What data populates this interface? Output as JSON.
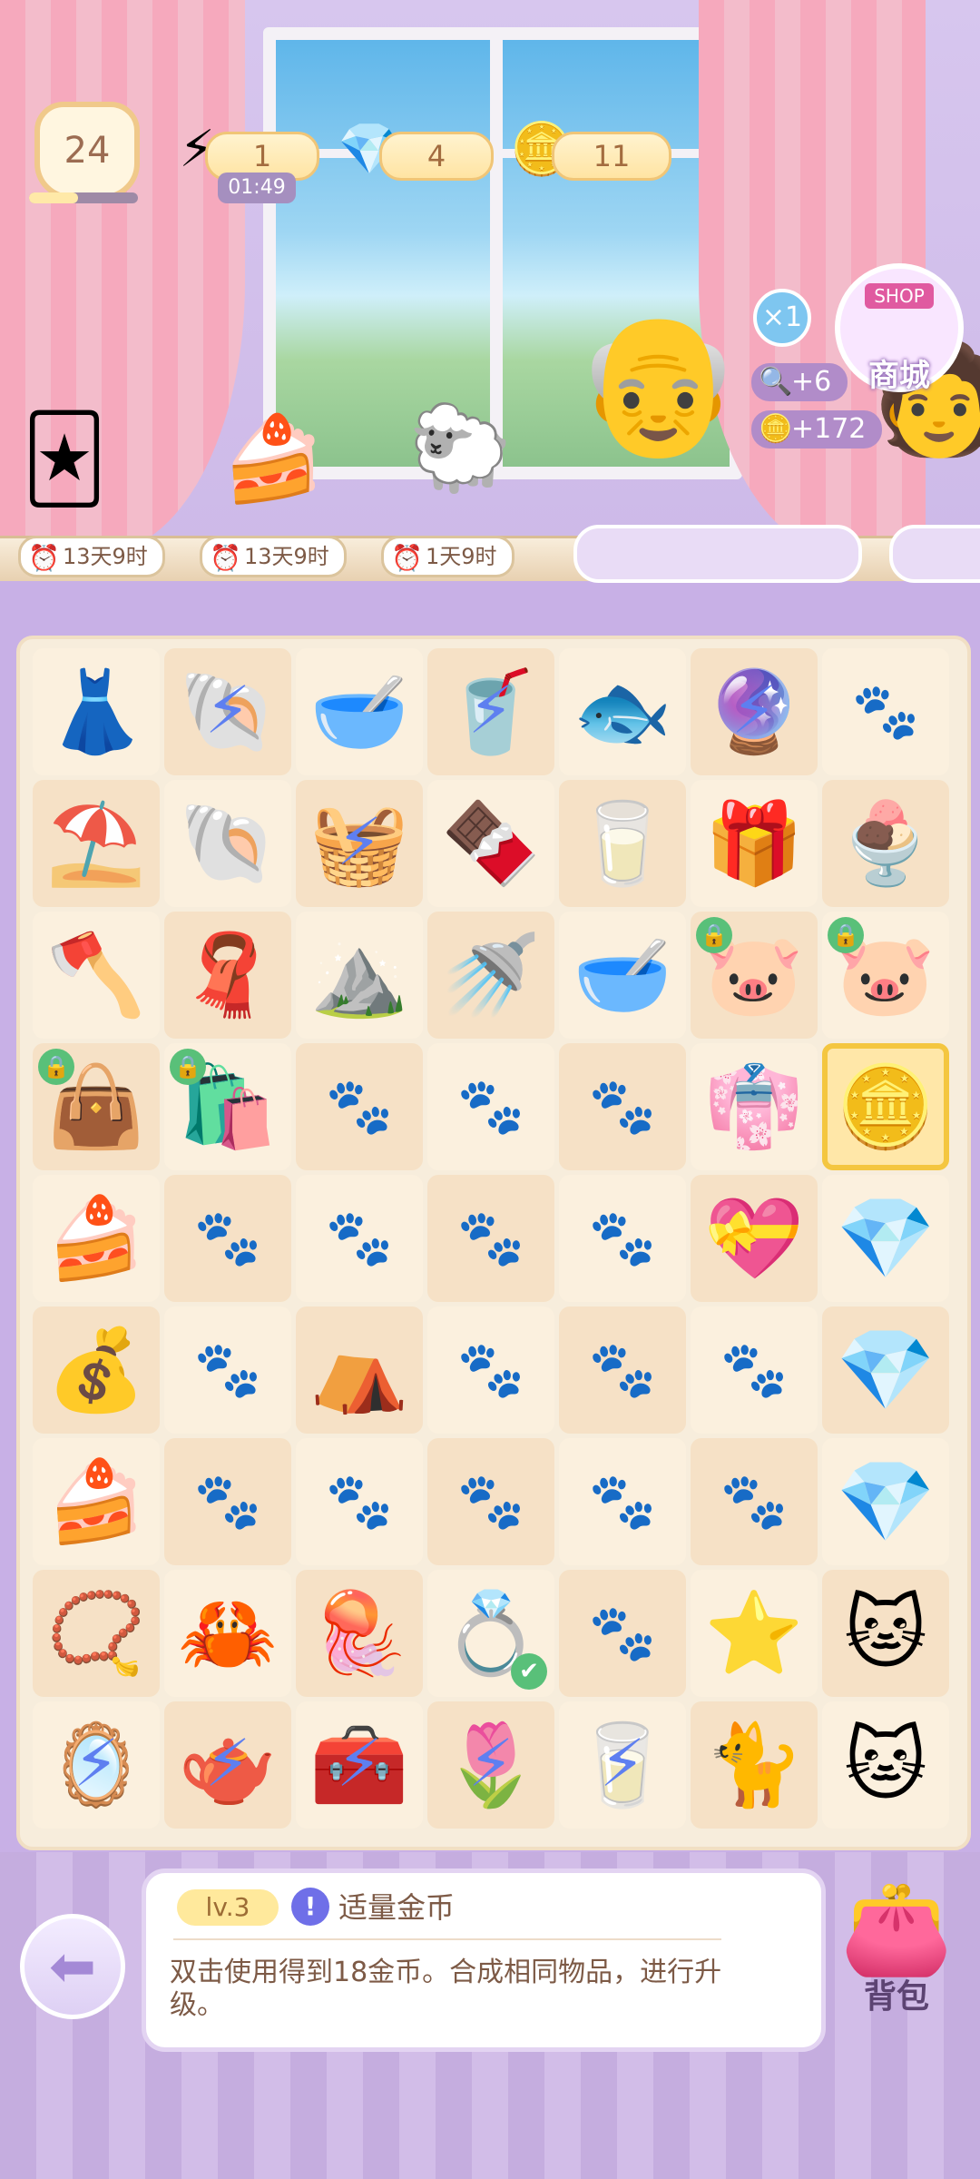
{
  "header": {
    "level": "24",
    "xp_fraction": 0.45,
    "energy": {
      "value": "1",
      "timer": "01:49"
    },
    "gems": {
      "value": "4"
    },
    "coins": {
      "value": "11"
    }
  },
  "events": [
    {
      "name": "card-album",
      "timer": "13天9时"
    },
    {
      "name": "strawberry-roll-cake",
      "timer": "13天9时"
    },
    {
      "name": "sheep-farm-event",
      "timer": "1天9时"
    }
  ],
  "shop": {
    "sign": "SHOP",
    "label": "商城"
  },
  "order": {
    "multiplier": "×1",
    "reward_search": "+6",
    "reward_coins": "+172"
  },
  "board": {
    "selected_cell": "r3c6",
    "cells": [
      [
        {
          "item": "gothic-dress",
          "icon": "👗"
        },
        {
          "item": "shell-energy",
          "icon": "🐚",
          "energy": true
        },
        {
          "item": "pet-bowl",
          "icon": "🥣"
        },
        {
          "item": "drink-energy",
          "icon": "🥤",
          "energy": true
        },
        {
          "item": "fish-tray",
          "icon": "🐟"
        },
        {
          "item": "shell-box-energy",
          "icon": "🔮",
          "energy": true
        },
        {
          "item": "empty"
        }
      ],
      [
        {
          "item": "sand-shovel",
          "icon": "⛱️"
        },
        {
          "item": "sand-shells",
          "icon": "🐚"
        },
        {
          "item": "hanger-energy",
          "icon": "🧺",
          "energy": true
        },
        {
          "item": "chocolate-machine",
          "icon": "🍫"
        },
        {
          "item": "milk-jug",
          "icon": "🥛"
        },
        {
          "item": "gift-box",
          "icon": "🎁"
        },
        {
          "item": "chocolate-bowl",
          "icon": "🍨"
        }
      ],
      [
        {
          "item": "shovel",
          "icon": "🪓"
        },
        {
          "item": "hanger-towel",
          "icon": "🧣"
        },
        {
          "item": "sand-pile",
          "icon": "⛰️"
        },
        {
          "item": "watering-can",
          "icon": "🚿"
        },
        {
          "item": "clay-bowl",
          "icon": "🥣"
        },
        {
          "item": "piggy-bank",
          "icon": "🐷",
          "locked": true
        },
        {
          "item": "piggy-bank-winged",
          "icon": "🐷",
          "locked": true
        }
      ],
      [
        {
          "item": "purple-bag",
          "icon": "👜",
          "locked": true
        },
        {
          "item": "blue-bag",
          "icon": "🛍️",
          "locked": true
        },
        {
          "item": "empty"
        },
        {
          "item": "empty"
        },
        {
          "item": "empty"
        },
        {
          "item": "pink-dress",
          "icon": "👘"
        },
        {
          "item": "coin-pile",
          "icon": "🪙"
        }
      ],
      [
        {
          "item": "strawberry-cake-box",
          "icon": "🍰"
        },
        {
          "item": "empty"
        },
        {
          "item": "empty"
        },
        {
          "item": "empty"
        },
        {
          "item": "empty"
        },
        {
          "item": "jewel-box",
          "icon": "💝"
        },
        {
          "item": "pink-gem",
          "icon": "💎"
        }
      ],
      [
        {
          "item": "gold-coins",
          "icon": "💰"
        },
        {
          "item": "empty"
        },
        {
          "item": "tent",
          "icon": "⛺"
        },
        {
          "item": "empty"
        },
        {
          "item": "empty"
        },
        {
          "item": "empty"
        },
        {
          "item": "pink-gems",
          "icon": "💎"
        }
      ],
      [
        {
          "item": "matcha-cake",
          "icon": "🍰"
        },
        {
          "item": "empty"
        },
        {
          "item": "empty"
        },
        {
          "item": "empty"
        },
        {
          "item": "empty"
        },
        {
          "item": "empty"
        },
        {
          "item": "pink-gem-pair",
          "icon": "💎"
        }
      ],
      [
        {
          "item": "pearl-headband",
          "icon": "📿"
        },
        {
          "item": "orange-crab",
          "icon": "🦀"
        },
        {
          "item": "blue-jellyfish",
          "icon": "🪼"
        },
        {
          "item": "earrings",
          "icon": "💍",
          "checked": true
        },
        {
          "item": "empty"
        },
        {
          "item": "starfish",
          "icon": "⭐"
        },
        {
          "item": "brown-cat",
          "icon": "🐱"
        }
      ],
      [
        {
          "item": "vanity-energy",
          "icon": "🪞",
          "energy": true
        },
        {
          "item": "tea-set-energy",
          "icon": "🫖",
          "energy": true
        },
        {
          "item": "jewelry-case-energy",
          "icon": "🧰",
          "energy": true
        },
        {
          "item": "flower-box-energy",
          "icon": "🌷",
          "energy": true
        },
        {
          "item": "water-glass-energy",
          "icon": "🥛",
          "energy": true
        },
        {
          "item": "siamese-cat",
          "icon": "🐈"
        },
        {
          "item": "calico-cat",
          "icon": "🐱"
        }
      ]
    ]
  },
  "info_panel": {
    "level": "lv.3",
    "item_name": "适量金币",
    "description": "双击使用得到18金币。合成相同物品，进行升级。"
  },
  "bag": {
    "label": "背包"
  }
}
